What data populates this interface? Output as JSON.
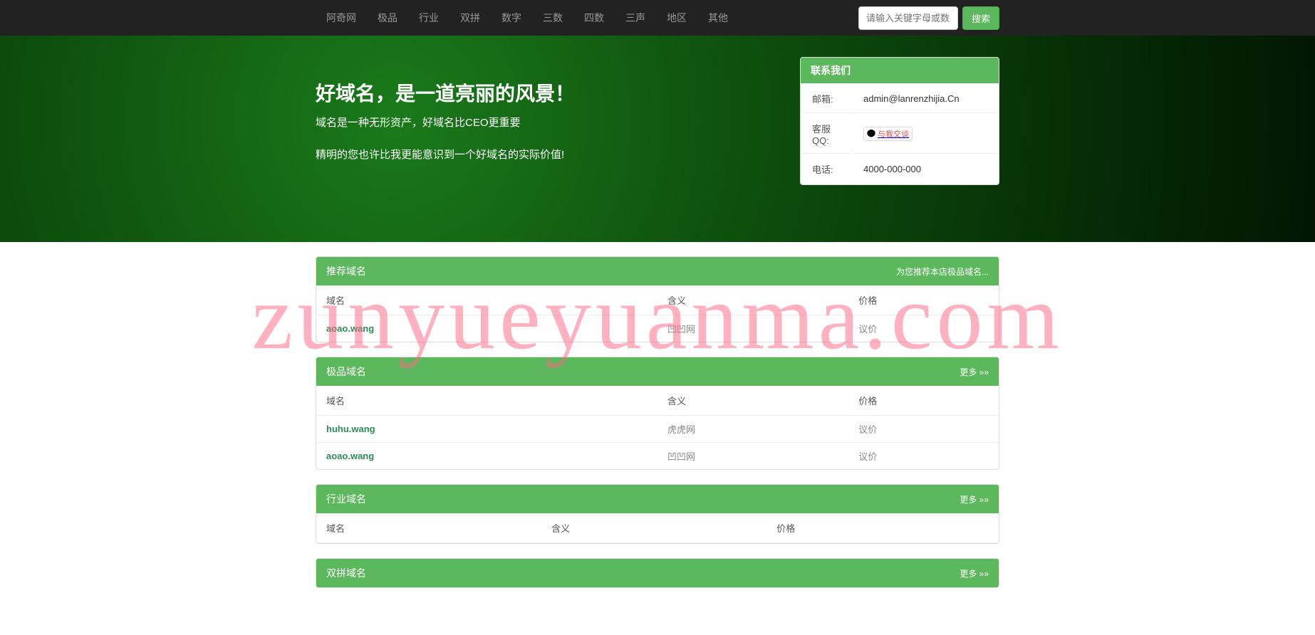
{
  "nav": {
    "items": [
      "阿奇网",
      "极品",
      "行业",
      "双拼",
      "数字",
      "三数",
      "四数",
      "三声",
      "地区",
      "其他"
    ],
    "search_placeholder": "请输入关键字母或数字",
    "search_button": "搜索"
  },
  "hero": {
    "title": "好域名，是一道亮丽的风景！",
    "subtitle": "域名是一种无形资产，好域名比CEO更重要",
    "tagline": "精明的您也许比我更能意识到一个好域名的实际价值!"
  },
  "contact": {
    "header": "联系我们",
    "rows": [
      {
        "label": "邮箱:",
        "value": "admin@lanrenzhijia.Cn"
      },
      {
        "label": "客服QQ:",
        "value": "与我交谈"
      },
      {
        "label": "电话:",
        "value": "4000-000-000"
      }
    ]
  },
  "panels": [
    {
      "title": "推荐域名",
      "more": "为您推荐本店极品域名...",
      "headers": [
        "域名",
        "含义",
        "价格"
      ],
      "rows": [
        {
          "domain": "aoao.wang",
          "meaning": "凹凹网",
          "price": "议价"
        }
      ]
    },
    {
      "title": "极品域名",
      "more": "更多 »»",
      "headers": [
        "域名",
        "含义",
        "价格"
      ],
      "rows": [
        {
          "domain": "huhu.wang",
          "meaning": "虎虎网",
          "price": "议价"
        },
        {
          "domain": "aoao.wang",
          "meaning": "凹凹网",
          "price": "议价"
        }
      ]
    },
    {
      "title": "行业域名",
      "more": "更多 »»",
      "headers": [
        "域名",
        "含义",
        "价格"
      ],
      "rows": []
    },
    {
      "title": "双拼域名",
      "more": "更多 »»",
      "headers": [],
      "rows": []
    }
  ],
  "watermark": "zunyueyuanma.com"
}
